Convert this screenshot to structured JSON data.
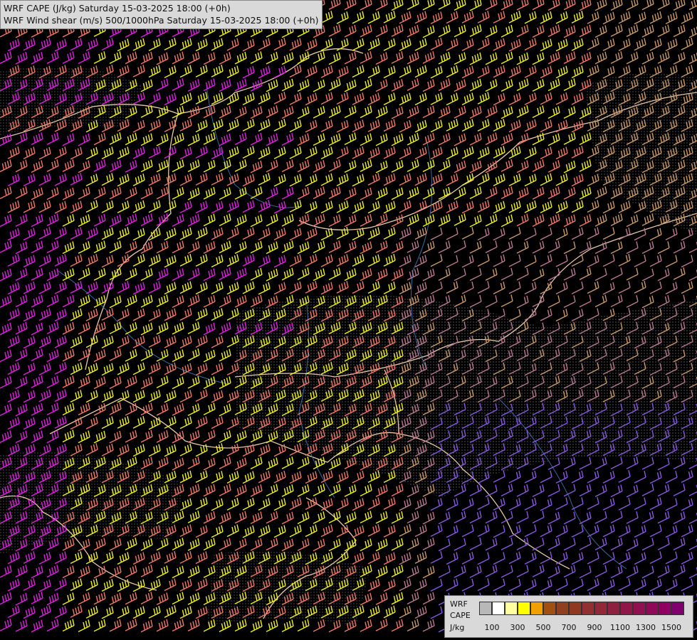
{
  "title": {
    "line1": "WRF CAPE (J/kg) Saturday 15-03-2025 18:00 (+0h)",
    "line2": "WRF Wind shear (m/s) 500/1000hPa Saturday 15-03-2025 18:00 (+0h)"
  },
  "legend": {
    "label_line1": "WRF",
    "label_line2": "CAPE",
    "label_line3": "J/kg",
    "colors": [
      "#b8b8b8",
      "#ffffff",
      "#ffffa0",
      "#ffff00",
      "#f0a000",
      "#a05010",
      "#904020",
      "#903820",
      "#903030",
      "#902838",
      "#902040",
      "#901848",
      "#901050",
      "#900858",
      "#900060",
      "#800070"
    ],
    "ticks": [
      "100",
      "300",
      "500",
      "700",
      "900",
      "1100",
      "1300",
      "1500"
    ]
  },
  "shear_colors": {
    "magenta": "#e020e0",
    "salmon": "#f07868",
    "yellow": "#f0f020",
    "tan": "#c89868",
    "mauve": "#b87890",
    "violet": "#8858e0"
  }
}
